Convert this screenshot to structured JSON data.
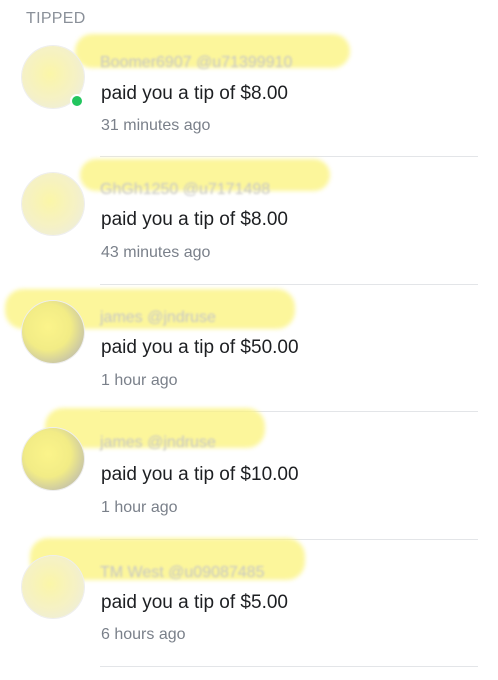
{
  "section_title": "TIPPED",
  "notifications": [
    {
      "name": "Boomer6907 @u71399910",
      "message": "paid you a tip of $8.00",
      "time": "31 minutes ago",
      "online": true
    },
    {
      "name": "GhGh1250 @u7171498",
      "message": "paid you a tip of $8.00",
      "time": "43 minutes ago",
      "online": false
    },
    {
      "name": "james @jndruse",
      "message": "paid you a tip of $50.00",
      "time": "1 hour ago",
      "online": false
    },
    {
      "name": "james @jndruse",
      "message": "paid you a tip of $10.00",
      "time": "1 hour ago",
      "online": false
    },
    {
      "name": "TM West @u09087485",
      "message": "paid you a tip of $5.00",
      "time": "6 hours ago",
      "online": false
    }
  ],
  "colors": {
    "online": "#22c55e",
    "highlight": "#fbf37a"
  }
}
